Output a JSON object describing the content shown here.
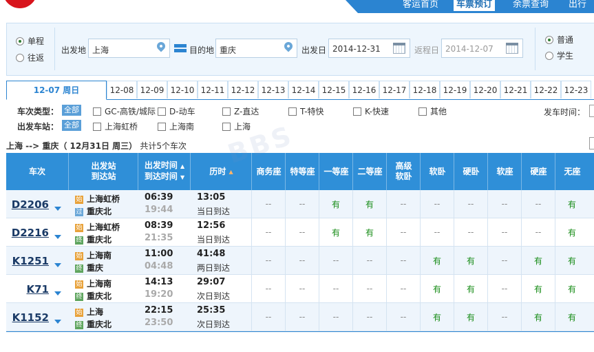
{
  "nav": {
    "items": [
      "客运首页",
      "车票预订",
      "余票查询",
      "出行"
    ],
    "active": "车票预订"
  },
  "search": {
    "trip_types": [
      {
        "label": "单程",
        "checked": true
      },
      {
        "label": "往返",
        "checked": false
      }
    ],
    "from_label": "出发地",
    "from_value": "上海",
    "to_label": "目的地",
    "to_value": "重庆",
    "depart_label": "出发日",
    "depart_value": "2014-12-31",
    "return_label": "返程日",
    "return_value": "2014-12-07",
    "passenger_types": [
      {
        "label": "普通",
        "checked": true
      },
      {
        "label": "学生",
        "checked": false
      }
    ]
  },
  "dates": {
    "active": "12-07  周日",
    "items": [
      "12-08",
      "12-09",
      "12-10",
      "12-11",
      "12-12",
      "12-13",
      "12-14",
      "12-15",
      "12-16",
      "12-17",
      "12-18",
      "12-19",
      "12-20",
      "12-21",
      "12-22",
      "12-23"
    ]
  },
  "filters": {
    "type_label": "车次类型：",
    "type_all": "全部",
    "types": [
      "GC-高铁/城际",
      "D-动车",
      "Z-直达",
      "T-特快",
      "K-快速",
      "其他"
    ],
    "station_label": "出发车站：",
    "station_all": "全部",
    "stations": [
      "上海虹桥",
      "上海南",
      "上海"
    ],
    "depart_time_label": "发车时间："
  },
  "summary": {
    "route": "上海 --> 重庆（ 12月31日  周三）",
    "count": "共计5个车次"
  },
  "table": {
    "headers": {
      "train": "车次",
      "stations": [
        "出发站",
        "到达站"
      ],
      "times": [
        "出发时间",
        "到达时间"
      ],
      "duration": "历时",
      "seats": [
        "商务座",
        "特等座",
        "一等座",
        "二等座",
        "高级\n软卧",
        "软卧",
        "硬卧",
        "软座",
        "硬座",
        "无座"
      ]
    },
    "rows": [
      {
        "train": "D2206",
        "from_tag": "始",
        "from": "上海虹桥",
        "to_tag": "过",
        "to": "重庆北",
        "dep": "06:39",
        "arr": "19:44",
        "dur": "13:05",
        "arrive_day": "当日到达",
        "seats": [
          "--",
          "--",
          "有",
          "有",
          "--",
          "--",
          "--",
          "--",
          "--",
          "有"
        ]
      },
      {
        "train": "D2216",
        "from_tag": "始",
        "from": "上海虹桥",
        "to_tag": "终",
        "to": "重庆北",
        "dep": "08:39",
        "arr": "21:35",
        "dur": "12:56",
        "arrive_day": "当日到达",
        "seats": [
          "--",
          "--",
          "有",
          "有",
          "--",
          "--",
          "--",
          "--",
          "--",
          "有"
        ]
      },
      {
        "train": "K1251",
        "from_tag": "始",
        "from": "上海南",
        "to_tag": "终",
        "to": "重庆",
        "dep": "11:00",
        "arr": "04:48",
        "dur": "41:48",
        "arrive_day": "两日到达",
        "seats": [
          "--",
          "--",
          "--",
          "--",
          "--",
          "有",
          "有",
          "--",
          "有",
          "有"
        ]
      },
      {
        "train": "K71",
        "from_tag": "始",
        "from": "上海南",
        "to_tag": "终",
        "to": "重庆北",
        "dep": "14:13",
        "arr": "19:20",
        "dur": "29:07",
        "arrive_day": "次日到达",
        "seats": [
          "--",
          "--",
          "--",
          "--",
          "--",
          "有",
          "有",
          "--",
          "有",
          "有"
        ]
      },
      {
        "train": "K1152",
        "from_tag": "始",
        "from": "上海",
        "to_tag": "终",
        "to": "重庆北",
        "dep": "22:15",
        "arr": "23:50",
        "dur": "25:35",
        "arrive_day": "次日到达",
        "seats": [
          "--",
          "--",
          "--",
          "--",
          "--",
          "有",
          "有",
          "--",
          "有",
          "有"
        ]
      }
    ]
  },
  "watermark": "BBS",
  "colors": {
    "accent": "#2b84d1",
    "available": "#178c17",
    "brand": "#d8141c"
  }
}
